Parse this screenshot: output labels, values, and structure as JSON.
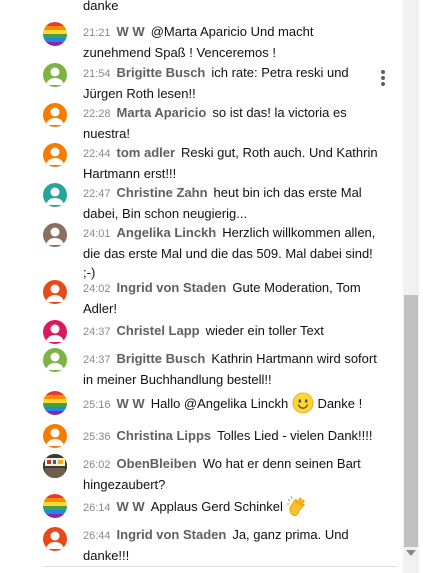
{
  "chat": {
    "partial_top_text": "danke",
    "messages": [
      {
        "time": "21:21",
        "author": "W W",
        "text": "@Marta Aparicio Und macht zunehmend Spaß ! Venceremos !",
        "avatar": "rainbow-flag-icon"
      },
      {
        "time": "21:54",
        "author": "Brigitte Busch",
        "text": "ich rate: Petra reski und Jürgen Roth lesen!!",
        "avatar": "default-avatar-icon",
        "avatar_color": "#7cb342"
      },
      {
        "time": "22:28",
        "author": "Marta Aparicio",
        "text": "so ist das! la victoria es nuestra!",
        "avatar": "default-avatar-icon",
        "avatar_color": "#f57c00"
      },
      {
        "time": "22:44",
        "author": "tom adler",
        "text": "Reski gut, Roth auch. Und Kathrin Hartmann erst!!!",
        "avatar": "default-avatar-icon",
        "avatar_color": "#f57c00"
      },
      {
        "time": "22:47",
        "author": "Christine Zahn",
        "text": "heut bin ich das erste Mal dabei, Bin schon neugierig...",
        "avatar": "default-avatar-icon",
        "avatar_color": "#26a69a"
      },
      {
        "time": "24:01",
        "author": "Angelika Linckh",
        "text": "Herzlich willkommen allen, die das erste Mal und die das 509. Mal dabei sind! ;-)",
        "avatar": "default-avatar-icon",
        "avatar_color": "#8d6e63"
      },
      {
        "time": "24:02",
        "author": "Ingrid von Staden",
        "text": "Gute Moderation, Tom Adler!",
        "avatar": "default-avatar-icon",
        "avatar_color": "#e64a19"
      },
      {
        "time": "24:37",
        "author": "Christel Lapp",
        "text": "wieder ein toller Text",
        "avatar": "default-avatar-icon",
        "avatar_color": "#d81b60"
      },
      {
        "time": "24:37",
        "author": "Brigitte Busch",
        "text": "Kathrin Hartmann wird sofort in meiner Buchhandlung bestell!!",
        "avatar": "default-avatar-icon",
        "avatar_color": "#7cb342"
      },
      {
        "time": "25:16",
        "author": "W W",
        "text_before": "Hallo @Angelika Linckh",
        "emoji": "smiling-face-icon",
        "text_after": "Danke !",
        "avatar": "rainbow-flag-icon"
      },
      {
        "time": "25:36",
        "author": "Christina Lipps",
        "text": "Tolles Lied - vielen Dank!!!!",
        "avatar": "default-avatar-icon",
        "avatar_color": "#f57c00"
      },
      {
        "time": "26:02",
        "author": "ObenBleiben",
        "text": "Wo hat er denn seinen Bart hingezaubert?",
        "avatar": "protest-photo-icon"
      },
      {
        "time": "26:14",
        "author": "W W",
        "text": "Applaus Gerd Schinkel",
        "emoji": "clapping-hands-icon",
        "avatar": "rainbow-flag-icon"
      },
      {
        "time": "26:44",
        "author": "Ingrid von Staden",
        "text": "Ja, ganz prima. Und danke!!!",
        "avatar": "default-avatar-icon",
        "avatar_color": "#e64a19"
      }
    ]
  },
  "scroll": {
    "position": 0.93
  }
}
